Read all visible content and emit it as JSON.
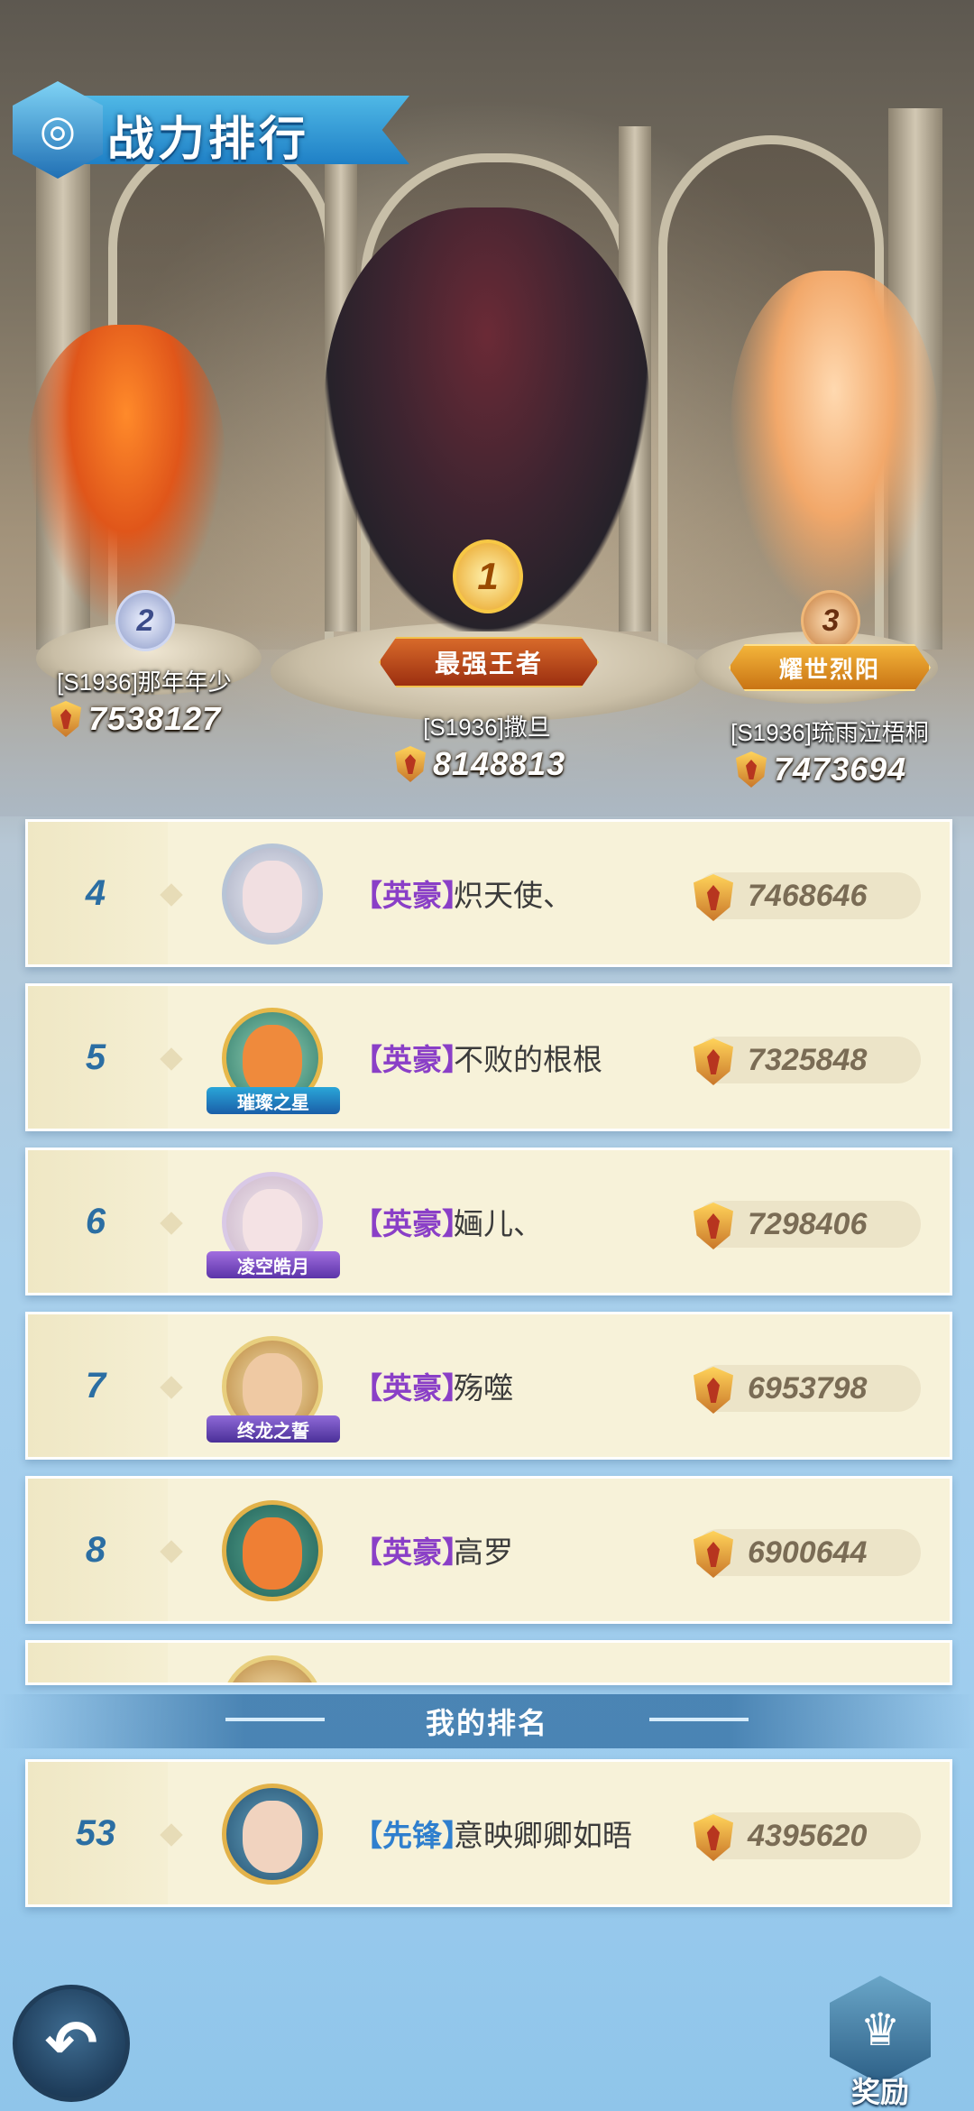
{
  "header": {
    "title": "战力排行"
  },
  "top3": [
    {
      "rank": "1",
      "title": "最强王者",
      "name": "[S1936]撒旦",
      "power": "8148813"
    },
    {
      "rank": "2",
      "title": "",
      "name": "[S1936]那年年少",
      "power": "7538127"
    },
    {
      "rank": "3",
      "title": "耀世烈阳",
      "name": "[S1936]琉雨泣梧桐",
      "power": "7473694"
    }
  ],
  "rows": [
    {
      "rank": "4",
      "guild": "【英豪】",
      "name": "炽天使、",
      "power": "7468646",
      "badge": ""
    },
    {
      "rank": "5",
      "guild": "【英豪】",
      "name": "不败的根根",
      "power": "7325848",
      "badge": "璀璨之星"
    },
    {
      "rank": "6",
      "guild": "【英豪】",
      "name": "婳儿、",
      "power": "7298406",
      "badge": "凌空皓月"
    },
    {
      "rank": "7",
      "guild": "【英豪】",
      "name": "殇噬",
      "power": "6953798",
      "badge": "终龙之誓"
    },
    {
      "rank": "8",
      "guild": "【英豪】",
      "name": "高罗",
      "power": "6900644",
      "badge": ""
    }
  ],
  "my_rank": {
    "label": "我的排名",
    "rank": "53",
    "guild": "【先锋】",
    "name": "意映卿卿如晤",
    "power": "4395620"
  },
  "buttons": {
    "back_icon": "↶",
    "reward_label": "奖励",
    "reward_icon": "♛"
  },
  "colors": {
    "accent": "#2b6ea3",
    "guild_purple": "#8a3fc7",
    "guild_blue": "#2f7fce",
    "row_bg": "#f7f2d9"
  }
}
